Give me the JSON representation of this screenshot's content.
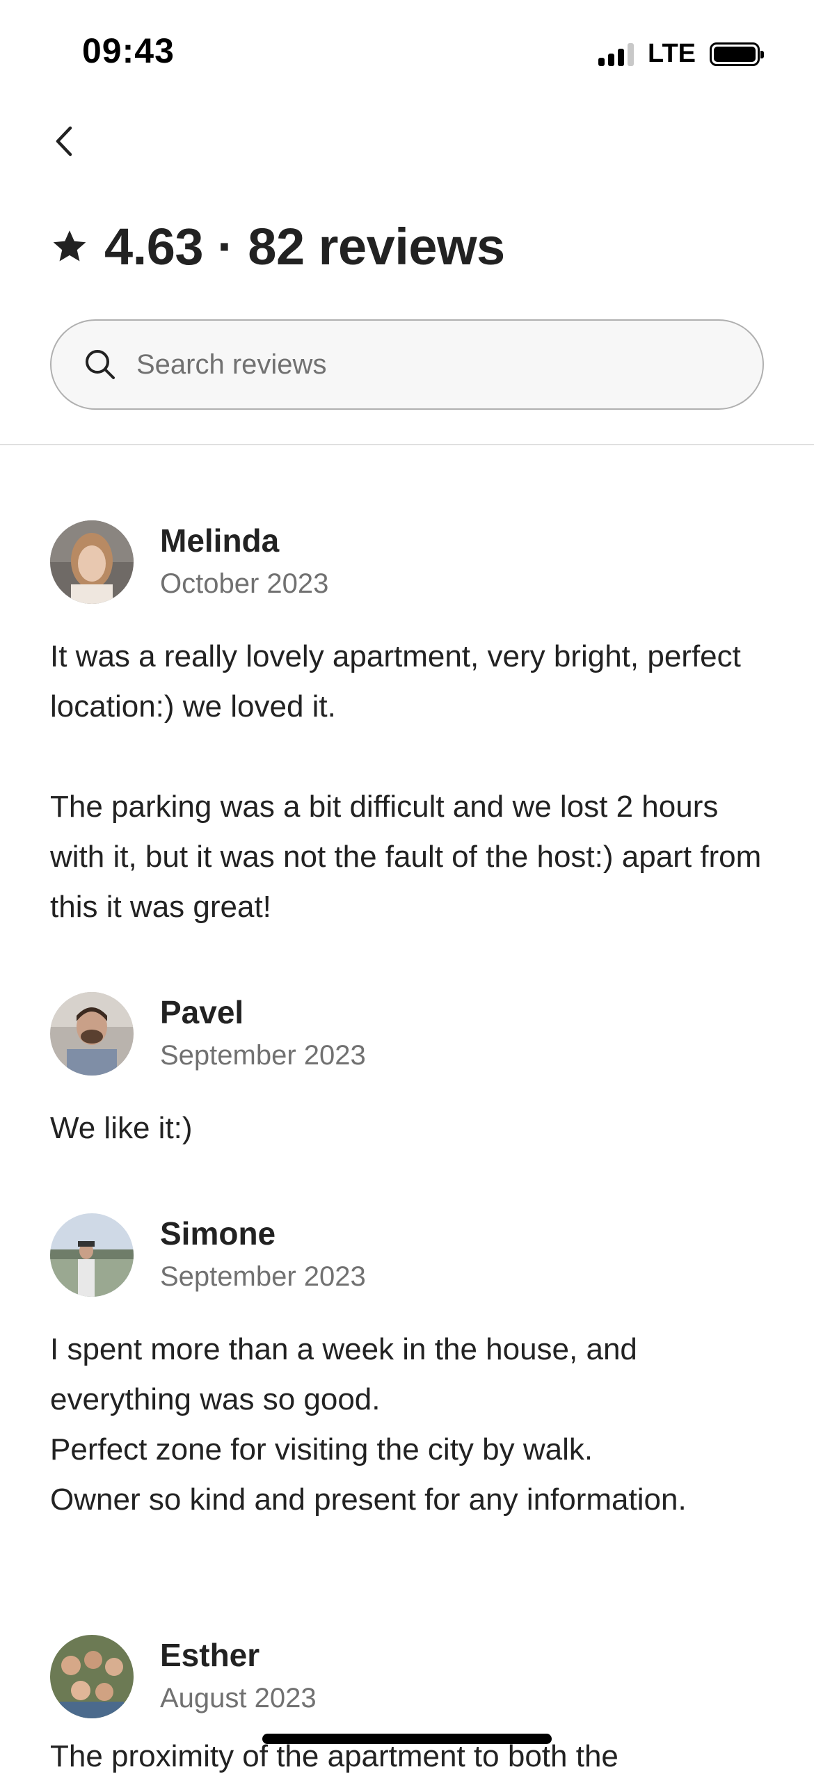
{
  "status_bar": {
    "time": "09:43",
    "network": "LTE"
  },
  "header": {
    "back_icon": "chevron-left-icon",
    "star_icon": "star-icon",
    "title": "4.63 · 82 reviews"
  },
  "search": {
    "icon": "search-icon",
    "placeholder": "Search reviews",
    "value": ""
  },
  "reviews": [
    {
      "name": "Melinda",
      "date": "October 2023",
      "paragraphs": [
        "It was a really lovely apartment, very bright, perfect location:) we loved it.",
        "The parking was a bit difficult and we lost 2 hours with it, but it was not the fault of the host:) apart from this it was great!"
      ]
    },
    {
      "name": "Pavel",
      "date": "September 2023",
      "paragraphs": [
        "We like it:)"
      ]
    },
    {
      "name": "Simone",
      "date": "September 2023",
      "lines": [
        "I spent more than a week in the house, and everything was so good.",
        "Perfect zone for visiting the city by walk.",
        "Owner so kind and present for any information."
      ]
    },
    {
      "name": "Esther",
      "date": "August 2023",
      "partial_text": "The proximity of the apartment to both the"
    }
  ],
  "colors": {
    "text_primary": "#222222",
    "text_secondary": "#717171",
    "search_background": "#f7f7f7",
    "divider": "#e0e0e0"
  }
}
